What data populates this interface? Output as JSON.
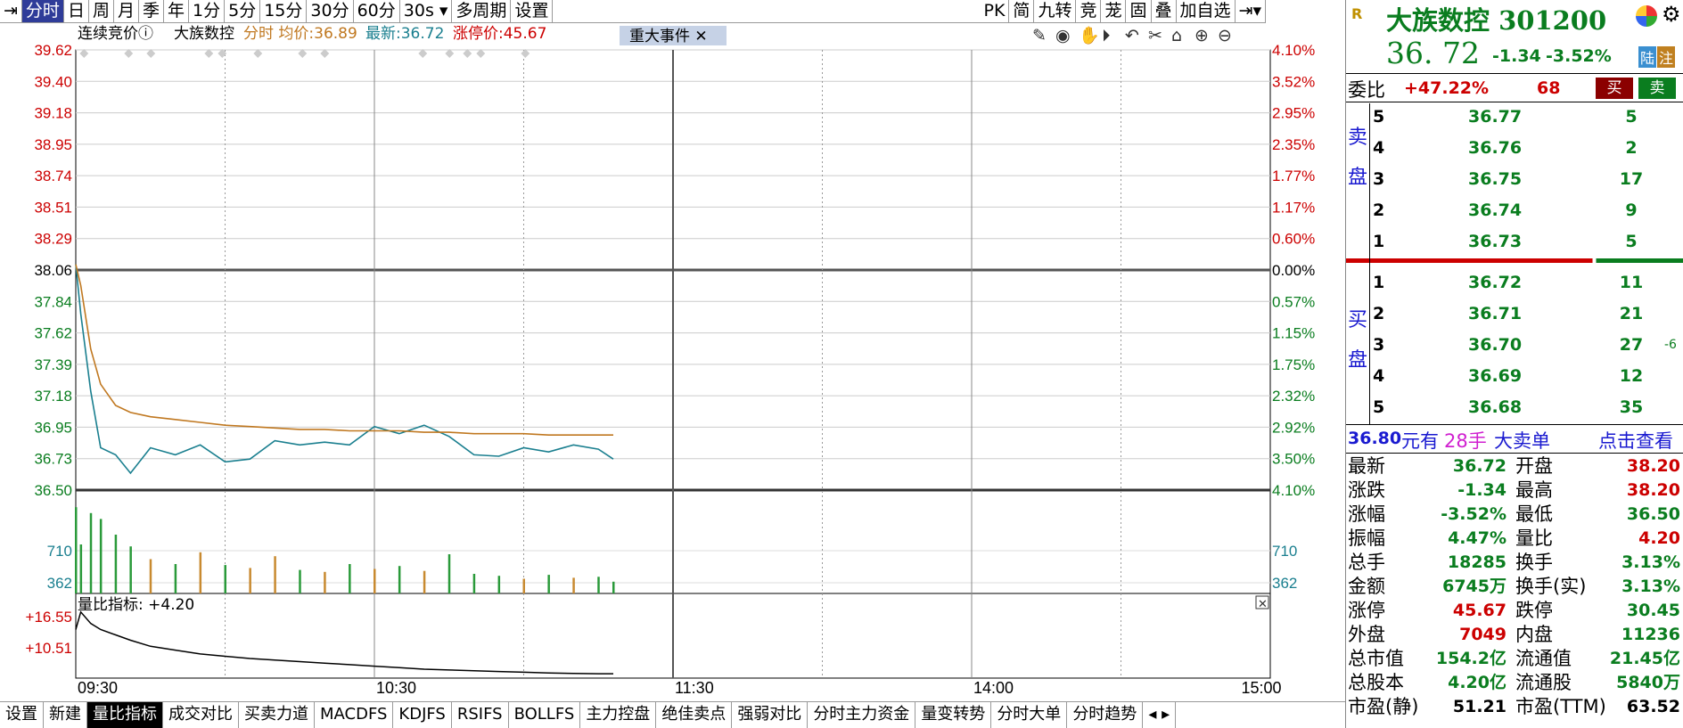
{
  "toolbar": {
    "tabs": [
      "分时",
      "日",
      "周",
      "月",
      "季",
      "年",
      "1分",
      "5分",
      "15分",
      "30分",
      "60分",
      "30s",
      "多周期",
      "设置"
    ],
    "right": [
      "PK",
      "简",
      "九转",
      "竞",
      "茏",
      "固",
      "叠",
      "加自选"
    ]
  },
  "legend": {
    "auction": "连续竞价",
    "name": "大族数控",
    "mode": "分时",
    "avg_label": "均价:",
    "avg": "36.89",
    "last_label": "最新:",
    "last": "36.72",
    "limit_label": "涨停价:",
    "limit": "45.67",
    "event": "重大事件"
  },
  "axis": {
    "left": [
      "39.62",
      "39.40",
      "39.18",
      "38.95",
      "38.74",
      "38.51",
      "38.29",
      "38.06",
      "37.84",
      "37.62",
      "37.39",
      "37.18",
      "36.95",
      "36.73",
      "36.50"
    ],
    "right": [
      "4.10%",
      "3.52%",
      "2.95%",
      "2.35%",
      "1.77%",
      "1.17%",
      "0.60%",
      "0.00%",
      "0.57%",
      "1.15%",
      "1.75%",
      "2.32%",
      "2.92%",
      "3.50%",
      "4.10%"
    ],
    "vol": [
      "710",
      "362"
    ],
    "ratio": [
      "+16.55",
      "+10.51"
    ],
    "time": [
      "09:30",
      "10:30",
      "11:30",
      "14:00",
      "15:00"
    ]
  },
  "ratio_label": "量比指标: +4.20",
  "bottom_tabs": [
    "设置",
    "新建",
    "量比指标",
    "成交对比",
    "买卖力道",
    "MACDFS",
    "KDJFS",
    "RSIFS",
    "BOLLFS",
    "主力控盘",
    "绝佳卖点",
    "强弱对比",
    "分时主力资金",
    "量变转势",
    "分时大单",
    "分时趋势"
  ],
  "side": {
    "badge": "R",
    "name": "大族数控 301200",
    "price": "36. 72",
    "chg": "-1.34",
    "pct": "-3.52%",
    "tags": [
      "陆",
      "注"
    ],
    "wei_label": "委比",
    "wei_pct": "+47.22%",
    "wei_num": "68",
    "buy_btn": "买",
    "sell_btn": "卖",
    "sell_label": [
      "卖",
      "盘"
    ],
    "buy_label": [
      "买",
      "盘"
    ],
    "asks": [
      [
        "5",
        "36.77",
        "5"
      ],
      [
        "4",
        "36.76",
        "2"
      ],
      [
        "3",
        "36.75",
        "17"
      ],
      [
        "2",
        "36.74",
        "9"
      ],
      [
        "1",
        "36.73",
        "5"
      ]
    ],
    "bids": [
      [
        "1",
        "36.72",
        "11",
        ""
      ],
      [
        "2",
        "36.71",
        "21",
        ""
      ],
      [
        "3",
        "36.70",
        "27",
        "-6"
      ],
      [
        "4",
        "36.69",
        "12",
        ""
      ],
      [
        "5",
        "36.68",
        "35",
        ""
      ]
    ],
    "big_price": "36.80",
    "big_unit": "元有",
    "big_qty": "28手",
    "big_text": "大卖单",
    "big_link": "点击查看",
    "info": [
      [
        "最新",
        "36.72",
        "开盘",
        "38.20"
      ],
      [
        "涨跌",
        "-1.34",
        "最高",
        "38.20"
      ],
      [
        "涨幅",
        "-3.52%",
        "最低",
        "36.50"
      ],
      [
        "振幅",
        "4.47%",
        "量比",
        "4.20"
      ],
      [
        "总手",
        "18285",
        "换手",
        "3.13%"
      ],
      [
        "金额",
        "6745万",
        "换手(实)",
        "3.13%"
      ],
      [
        "涨停",
        "45.67",
        "跌停",
        "30.45"
      ],
      [
        "外盘",
        "7049",
        "内盘",
        "11236"
      ],
      [
        "总市值",
        "154.2亿",
        "流通值",
        "21.45亿"
      ],
      [
        "总股本",
        "4.20亿",
        "流通股",
        "5840万"
      ],
      [
        "市盈(静)",
        "51.21",
        "市盈(TTM)",
        "63.52"
      ]
    ],
    "colors": {
      "up": "#c00000",
      "down": "#0a7d1f",
      "price": "#1a7f8f",
      "avg": "#c07820"
    }
  },
  "chart_data": {
    "type": "line",
    "x": [
      "09:30",
      "09:31",
      "09:33",
      "09:35",
      "09:38",
      "09:41",
      "09:45",
      "09:50",
      "09:55",
      "10:00",
      "10:05",
      "10:10",
      "10:15",
      "10:20",
      "10:25",
      "10:30",
      "10:35",
      "10:40",
      "10:45",
      "10:50",
      "10:55",
      "11:00",
      "11:05",
      "11:10",
      "11:15",
      "11:18"
    ],
    "series": [
      {
        "name": "最新",
        "values": [
          38.1,
          37.75,
          37.2,
          36.8,
          36.75,
          36.62,
          36.8,
          36.75,
          36.82,
          36.7,
          36.72,
          36.85,
          36.82,
          36.84,
          36.82,
          36.95,
          36.9,
          36.96,
          36.88,
          36.75,
          36.74,
          36.8,
          36.77,
          36.82,
          36.79,
          36.72
        ]
      },
      {
        "name": "均价",
        "values": [
          38.1,
          37.95,
          37.5,
          37.25,
          37.1,
          37.05,
          37.02,
          37.0,
          36.98,
          36.96,
          36.95,
          36.94,
          36.93,
          36.93,
          36.92,
          36.92,
          36.92,
          36.91,
          36.91,
          36.9,
          36.9,
          36.9,
          36.89,
          36.89,
          36.89,
          36.89
        ]
      }
    ],
    "volume": [
      880,
      500,
      820,
      760,
      600,
      480,
      350,
      300,
      420,
      290,
      260,
      380,
      240,
      220,
      300,
      250,
      280,
      230,
      400,
      200,
      180,
      150,
      190,
      160,
      170,
      120
    ],
    "ratio": [
      14.2,
      16.5,
      15.0,
      14.2,
      13.5,
      12.8,
      12.0,
      11.5,
      11.0,
      10.7,
      10.4,
      10.2,
      10.0,
      9.8,
      9.6,
      9.4,
      9.2,
      9.0,
      8.9,
      8.8,
      8.7,
      8.6,
      8.5,
      8.45,
      8.4,
      8.4
    ],
    "ylim": [
      36.5,
      39.62
    ],
    "prev_close": 38.06,
    "vol_max": 1000,
    "ratio_lim": [
      8.3,
      18.0
    ]
  }
}
